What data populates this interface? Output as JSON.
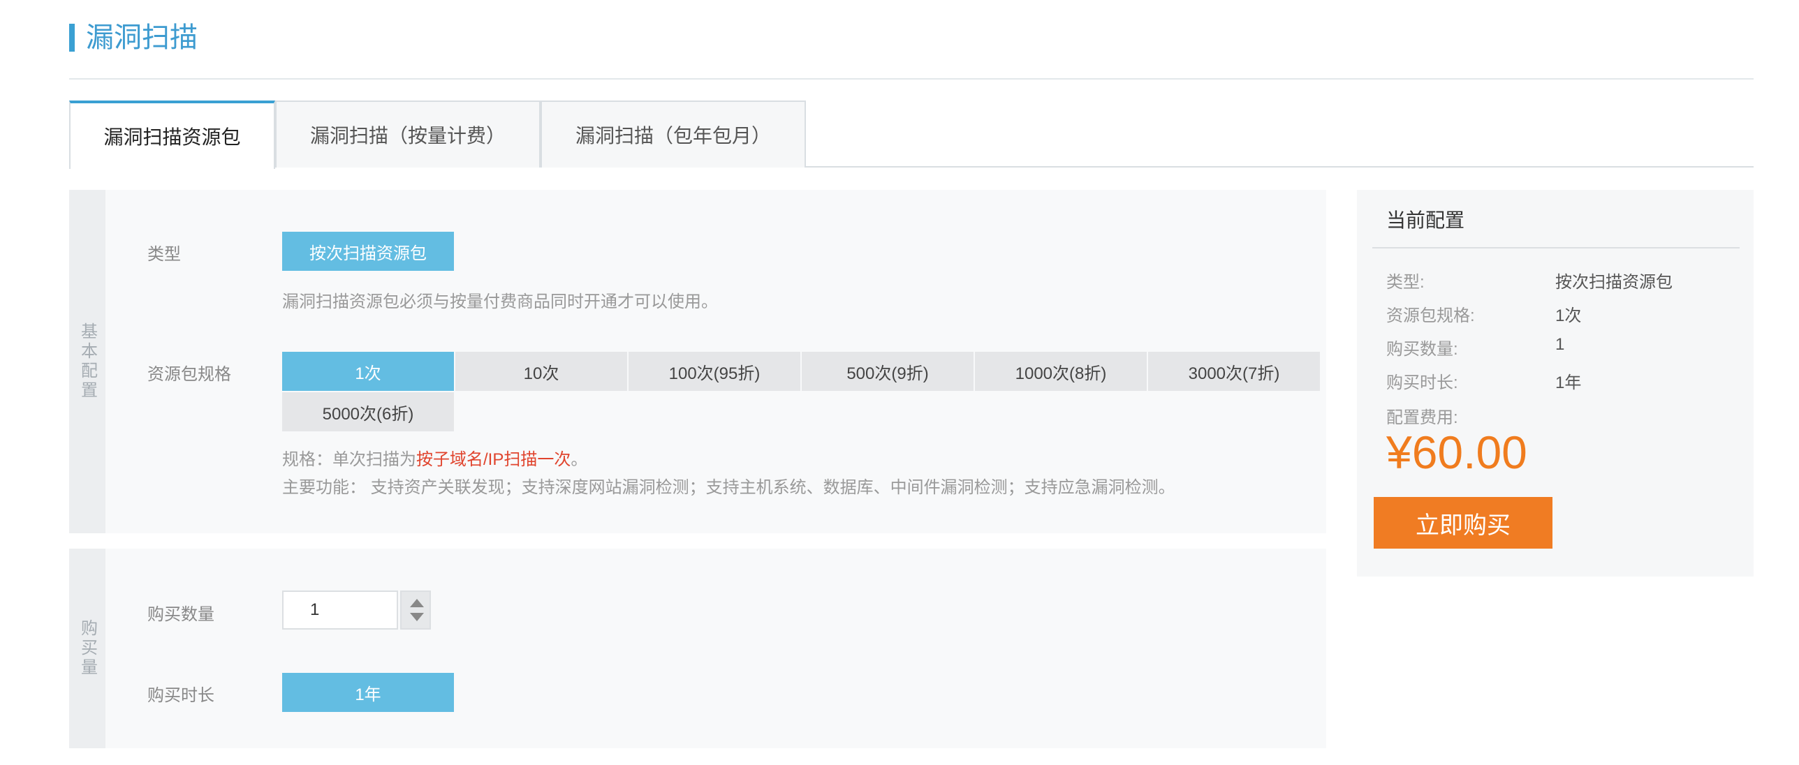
{
  "header": {
    "title": "漏洞扫描"
  },
  "tabs": [
    {
      "label": "漏洞扫描资源包"
    },
    {
      "label": "漏洞扫描（按量计费）"
    },
    {
      "label": "漏洞扫描（包年包月）"
    }
  ],
  "basic": {
    "side_label": "基本配置",
    "type_label": "类型",
    "type_option": "按次扫描资源包",
    "type_note": "漏洞扫描资源包必须与按量付费商品同时开通才可以使用。",
    "spec_label": "资源包规格",
    "spec_options": [
      "1次",
      "10次",
      "100次(95折)",
      "500次(9折)",
      "1000次(8折)",
      "3000次(7折)",
      "5000次(6折)"
    ],
    "spec_note_prefix": "规格：单次扫描为",
    "spec_note_highlight": "按子域名/IP扫描一次",
    "spec_note_suffix": "。",
    "features": "主要功能：  支持资产关联发现；支持深度网站漏洞检测；支持主机系统、数据库、中间件漏洞检测；支持应急漏洞检测。"
  },
  "purchase": {
    "side_label": "购买量",
    "qty_label": "购买数量",
    "qty_value": "1",
    "duration_label": "购买时长",
    "duration_option": "1年"
  },
  "summary": {
    "title": "当前配置",
    "rows": [
      {
        "key": "类型:",
        "value": "按次扫描资源包"
      },
      {
        "key": "资源包规格:",
        "value": "1次"
      },
      {
        "key": "购买数量:",
        "value": "1"
      },
      {
        "key": "购买时长:",
        "value": "1年"
      }
    ],
    "fee_label": "配置费用:",
    "price": "¥60.00",
    "buy_label": "立即购买"
  },
  "colors": {
    "accent": "#3aa0d3",
    "selected": "#63bde2",
    "highlight": "#e0442d",
    "price": "#f07c1e",
    "buy": "#f07c23"
  }
}
